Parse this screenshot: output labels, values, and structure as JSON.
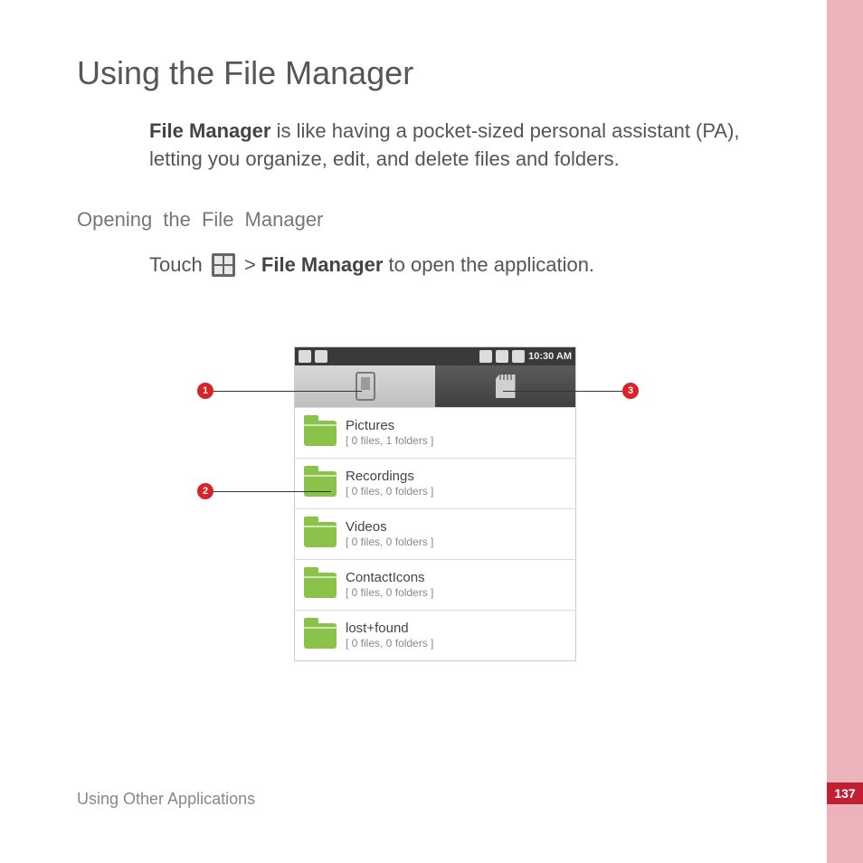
{
  "page": {
    "title": "Using the File Manager",
    "intro_bold": "File Manager",
    "intro_rest": " is like having a pocket-sized personal assistant (PA), letting you organize, edit, and delete files and folders.",
    "subhead": "Opening the File Manager",
    "touch_pre": "Touch ",
    "touch_mid": " > ",
    "touch_bold": "File Manager",
    "touch_post": " to open the application.",
    "footer": "Using Other Applications",
    "number": "137"
  },
  "phone": {
    "time": "10:30 AM",
    "rows": [
      {
        "name": "Pictures",
        "meta": "[ 0 files, 1 folders  ]"
      },
      {
        "name": "Recordings",
        "meta": "[ 0 files, 0 folders  ]"
      },
      {
        "name": "Videos",
        "meta": "[ 0 files, 0 folders  ]"
      },
      {
        "name": "ContactIcons",
        "meta": "[ 0 files, 0 folders  ]"
      },
      {
        "name": "lost+found",
        "meta": "[ 0 files, 0 folders  ]"
      }
    ]
  },
  "callouts": {
    "c1": "1",
    "c2": "2",
    "c3": "3"
  }
}
